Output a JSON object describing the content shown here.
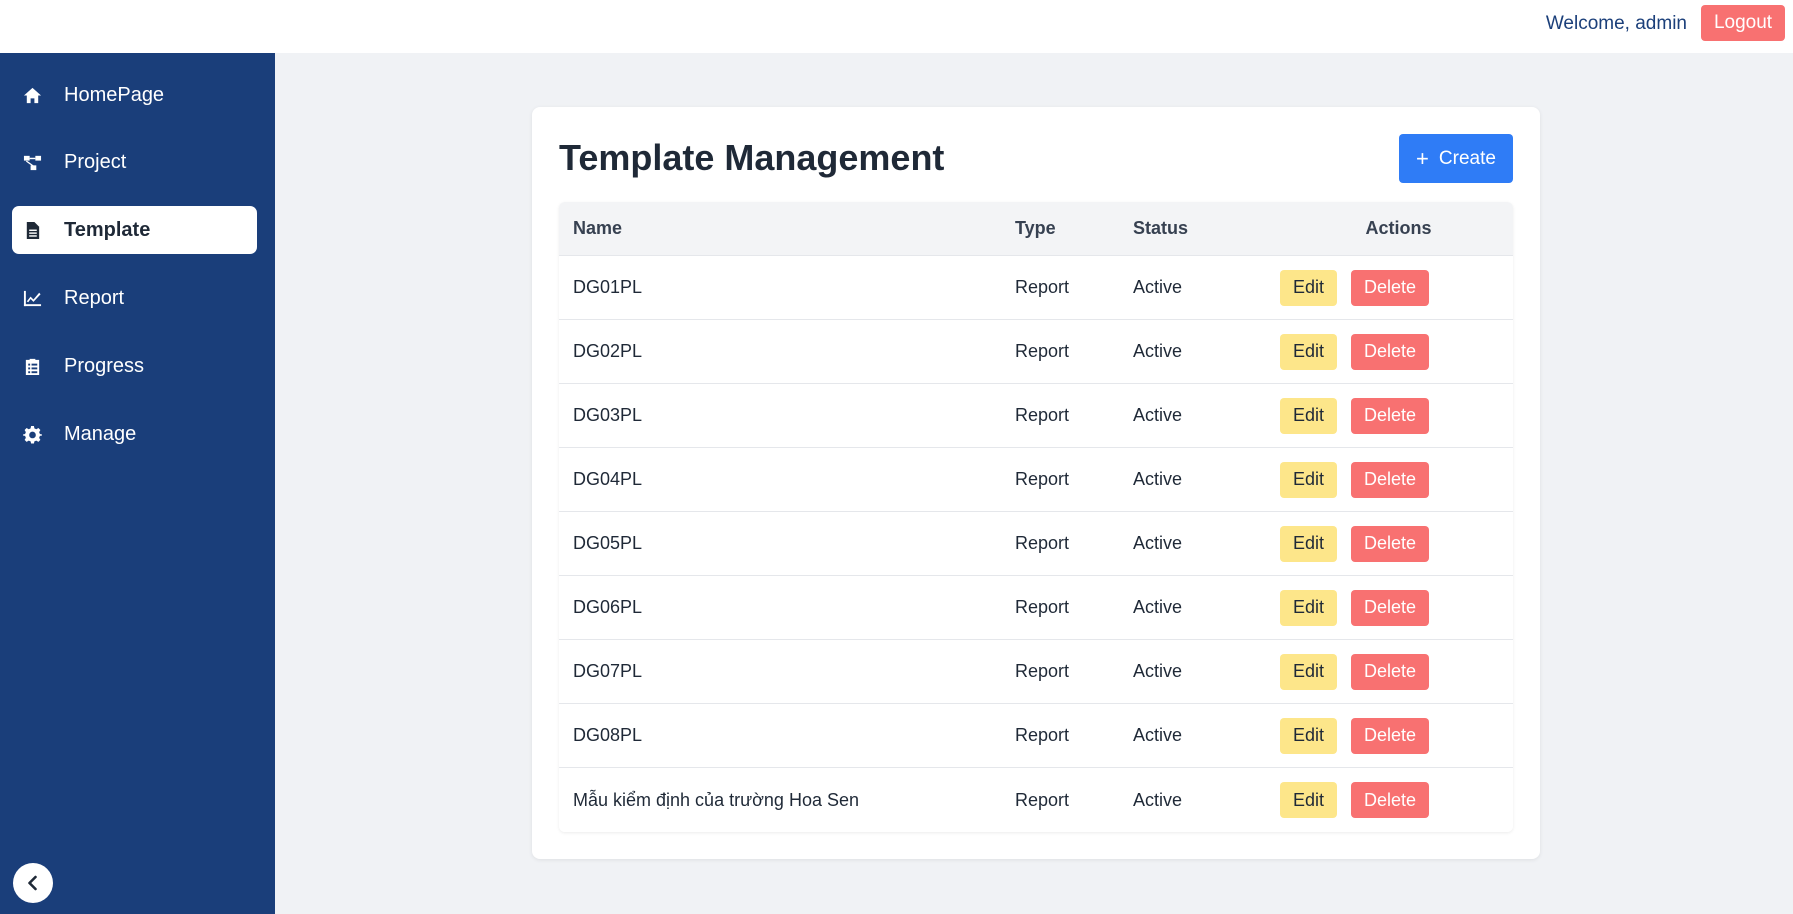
{
  "header": {
    "welcome_text": "Welcome, admin",
    "logout_label": "Logout"
  },
  "sidebar": {
    "items": [
      {
        "label": "HomePage",
        "icon": "home-icon",
        "active": false
      },
      {
        "label": "Project",
        "icon": "project-tree-icon",
        "active": false
      },
      {
        "label": "Template",
        "icon": "file-icon",
        "active": true
      },
      {
        "label": "Report",
        "icon": "chart-line-icon",
        "active": false
      },
      {
        "label": "Progress",
        "icon": "clipboard-list-icon",
        "active": false
      },
      {
        "label": "Manage",
        "icon": "gear-icon",
        "active": false
      }
    ],
    "collapse_icon": "chevron-left-icon"
  },
  "main": {
    "title": "Template Management",
    "create_label": "Create",
    "table": {
      "columns": [
        "Name",
        "Type",
        "Status",
        "Actions"
      ],
      "rows": [
        {
          "name": "DG01PL",
          "type": "Report",
          "status": "Active"
        },
        {
          "name": "DG02PL",
          "type": "Report",
          "status": "Active"
        },
        {
          "name": "DG03PL",
          "type": "Report",
          "status": "Active"
        },
        {
          "name": "DG04PL",
          "type": "Report",
          "status": "Active"
        },
        {
          "name": "DG05PL",
          "type": "Report",
          "status": "Active"
        },
        {
          "name": "DG06PL",
          "type": "Report",
          "status": "Active"
        },
        {
          "name": "DG07PL",
          "type": "Report",
          "status": "Active"
        },
        {
          "name": "DG08PL",
          "type": "Report",
          "status": "Active"
        },
        {
          "name": "Mẫu kiểm định của trường Hoa Sen",
          "type": "Report",
          "status": "Active"
        }
      ],
      "edit_label": "Edit",
      "delete_label": "Delete"
    }
  },
  "colors": {
    "sidebar_bg": "#1a3e7a",
    "create_button": "#2f7cf6",
    "edit_button": "#fde68a",
    "delete_button": "#f87171"
  }
}
